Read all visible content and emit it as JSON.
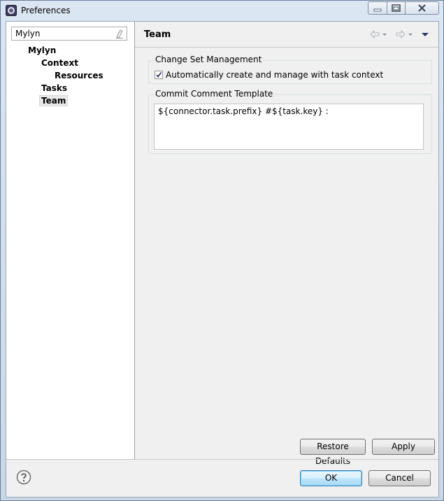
{
  "window": {
    "title": "Preferences"
  },
  "filter": {
    "value": "Mylyn"
  },
  "tree": {
    "items": [
      {
        "label": "Mylyn"
      },
      {
        "label": "Context"
      },
      {
        "label": "Resources"
      },
      {
        "label": "Tasks"
      },
      {
        "label": "Team"
      }
    ]
  },
  "page": {
    "title": "Team",
    "change_set_group": {
      "label": "Change Set Management",
      "checkbox_label": "Automatically create and manage with task context",
      "checked": true
    },
    "commit_group": {
      "label": "Commit Comment Template",
      "template": "${connector.task.prefix} #${task.key} :"
    },
    "restore_defaults_label": "Restore Defaults",
    "apply_label": "Apply"
  },
  "dialog": {
    "ok_label": "OK",
    "cancel_label": "Cancel"
  },
  "icons": [
    "eclipse-app-icon",
    "minimize-icon",
    "maximize-icon",
    "close-icon",
    "eraser-icon",
    "back-arrow-icon",
    "chevron-down-icon",
    "forward-arrow-icon",
    "view-menu-icon",
    "help-icon",
    "checkmark-icon"
  ]
}
